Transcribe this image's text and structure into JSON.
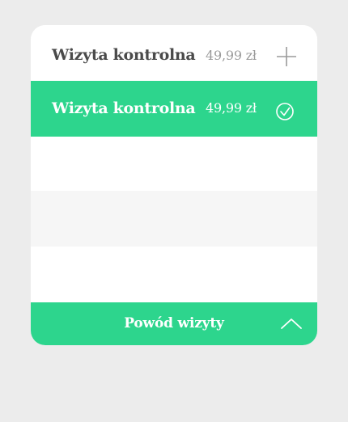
{
  "services": [
    {
      "name": "Wizyta kontrolna",
      "price": "49,99 zł",
      "selected": false,
      "action_icon": "plus-icon"
    },
    {
      "name": "Wizyta kontrolna",
      "price": "49,99 zł",
      "selected": true,
      "action_icon": "check-circle-icon"
    }
  ],
  "footer": {
    "label": "Powód wizyty",
    "toggle_icon": "chevron-up-icon"
  },
  "colors": {
    "accent": "#2dd58d",
    "page_background": "#ececec",
    "card_background": "#ffffff",
    "striped_row": "#f6f6f6",
    "text_dark": "#4a4a4a",
    "text_muted": "#9a9a9a"
  }
}
